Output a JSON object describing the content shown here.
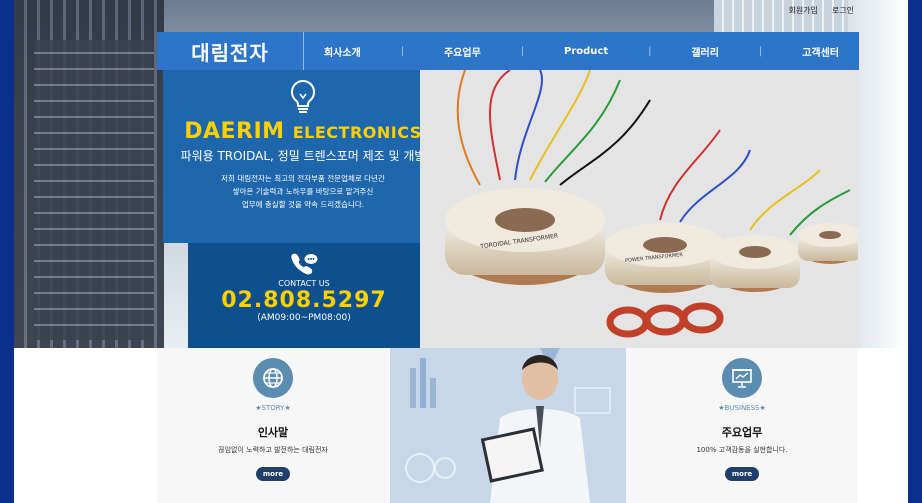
{
  "header": {
    "toplinks": {
      "join": "회원가입",
      "login": "로그인"
    },
    "logo": "대림전자",
    "menu": [
      "회사소개",
      "주요업무",
      "Product",
      "갤러리",
      "고객센터"
    ]
  },
  "hero": {
    "brand_main": "DAERIM",
    "brand_sub": "ELECTRONICS",
    "subtitle": "파워용 TROIDAL, 정밀 트렌스포머 제조 및 개발",
    "desc_lines": [
      "저희 대림전자는 최고의 전자부품 전문업체로 다년간",
      "쌓아온 기술력과 노하우를 바탕으로 맡겨주신",
      "업무에 충실할 것을 약속 드리겠습니다."
    ],
    "contact_label": "CONTACT US",
    "phone": "02.808.5297",
    "hours": "(AM09:00~PM08:00)"
  },
  "product_labels": {
    "toroidal": "TOROIDAL TRANSFORMER",
    "power": "POWER TRANSFORMER"
  },
  "cards": {
    "story": {
      "tag": "★STORY★",
      "title": "인사말",
      "desc": "끊임없이 노력하고 발전하는 대림전자",
      "more": "more"
    },
    "business": {
      "tag": "★BUSINESS★",
      "title": "주요업무",
      "desc": "100% 고객감동을 실현합니다.",
      "more": "more"
    }
  },
  "icons": {
    "bulb": "lightbulb-icon",
    "phone": "phone-chat-icon",
    "globe": "globe-icon",
    "presentation": "presentation-chart-icon"
  },
  "colors": {
    "nav": "#2d75c9",
    "accent": "#ffd000",
    "panel": "#1f67ad",
    "panel_dark": "#0e4f8d",
    "icon_circle": "#5b8cb2",
    "button": "#1f3f6c"
  }
}
